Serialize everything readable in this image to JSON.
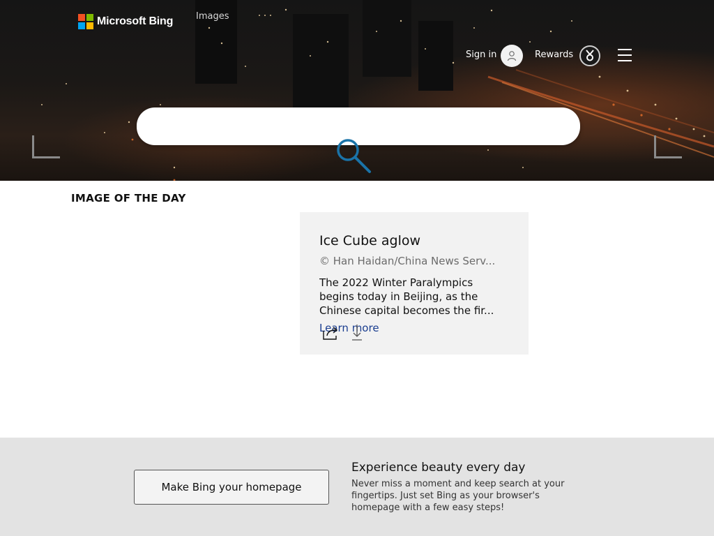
{
  "header": {
    "logo_text": "Microsoft Bing",
    "logo_colors": [
      "#f25022",
      "#7fba00",
      "#00a4ef",
      "#ffb900"
    ],
    "nav_images": "Images",
    "sign_in": "Sign in",
    "rewards": "Rewards",
    "icons": {
      "avatar": "person-icon",
      "rewards": "medal-icon",
      "menu": "hamburger-menu-icon"
    }
  },
  "search": {
    "placeholder": "",
    "icon": "search-icon",
    "icon_color": "#1a73a8"
  },
  "image_of_the_day": {
    "heading": "IMAGE OF THE DAY",
    "title": "Ice Cube aglow",
    "copyright": "© Han Haidan/China News Serv...",
    "description_line1": "The 2022 Winter Paralympics",
    "description_line2": "begins today in Beijing, as the",
    "description_line3": "Chinese capital becomes the fir...",
    "learn_more": "Learn more",
    "icons": {
      "share": "share-icon",
      "download": "download-icon"
    }
  },
  "banner": {
    "button_label": "Make Bing your homepage",
    "title": "Experience beauty every day",
    "text": "Never miss a moment and keep search at your fingertips. Just set Bing as your browser's homepage with a few easy steps!"
  }
}
